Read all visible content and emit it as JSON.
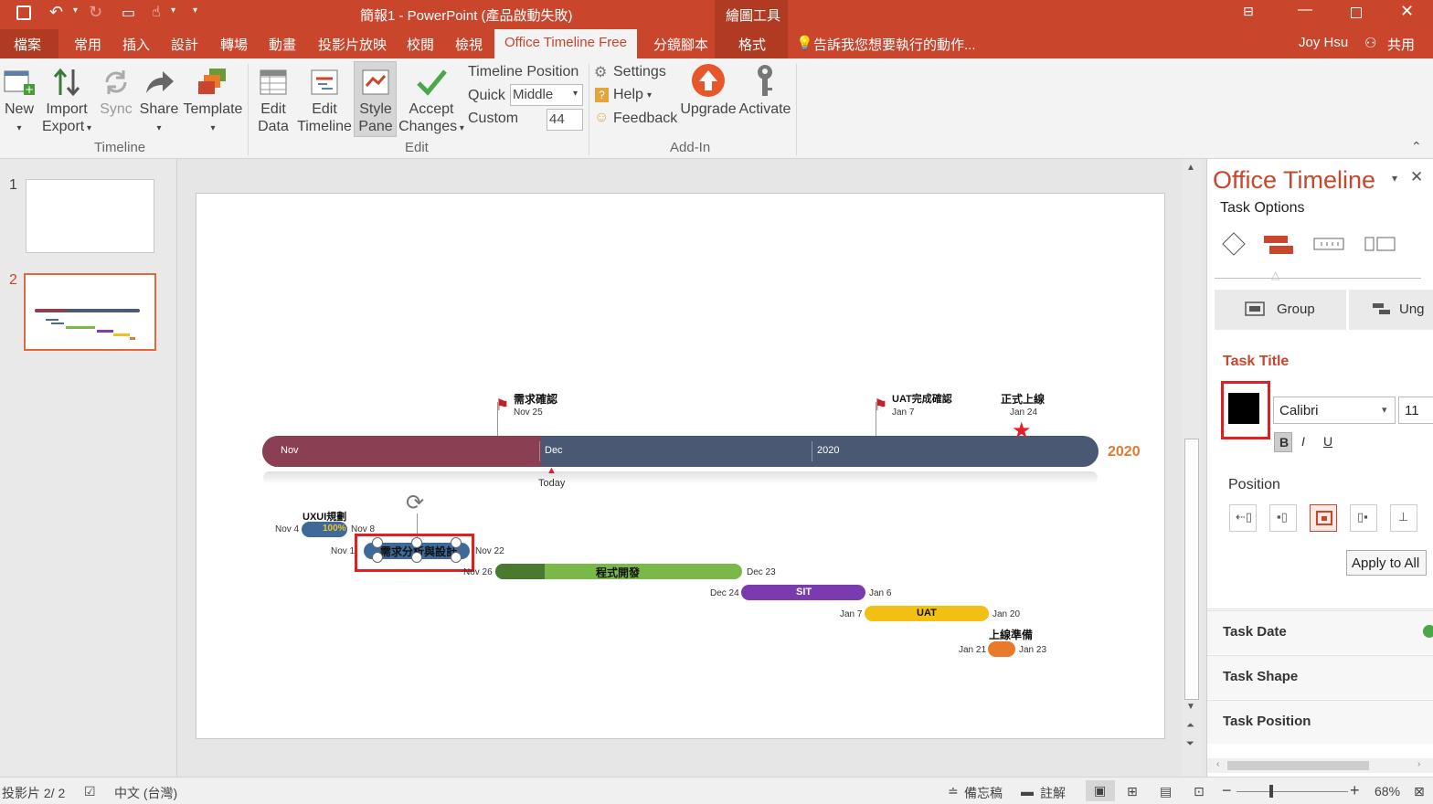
{
  "window": {
    "title": "簡報1 - PowerPoint (產品啟動失敗)",
    "contextual_tab_group": "繪圖工具"
  },
  "tabs": {
    "file": "檔案",
    "home": "常用",
    "insert": "插入",
    "design": "設計",
    "transitions": "轉場",
    "animations": "動畫",
    "slideshow": "投影片放映",
    "review": "校閱",
    "view": "檢視",
    "office_timeline": "Office Timeline Free",
    "storyboard": "分鏡腳本",
    "format": "格式",
    "tell_me": "告訴我您想要執行的動作...",
    "user": "Joy Hsu",
    "share": "共用"
  },
  "ribbon": {
    "new": "New",
    "import": "Import",
    "export": "Export",
    "sync": "Sync",
    "share": "Share",
    "template": "Template",
    "group_timeline": "Timeline",
    "edit_data_1": "Edit",
    "edit_data_2": "Data",
    "edit_timeline_1": "Edit",
    "edit_timeline_2": "Timeline",
    "style_pane_1": "Style",
    "style_pane_2": "Pane",
    "accept_1": "Accept",
    "accept_2": "Changes",
    "timeline_position": "Timeline Position",
    "quick": "Quick",
    "quick_value": "Middle",
    "custom": "Custom",
    "custom_value": "44",
    "group_edit": "Edit",
    "settings": "Settings",
    "help": "Help",
    "feedback": "Feedback",
    "upgrade": "Upgrade",
    "activate": "Activate",
    "group_addin": "Add-In"
  },
  "thumbnails": {
    "n1": "1",
    "n2": "2"
  },
  "timeline": {
    "milestones": [
      {
        "title": "需求確認",
        "date": "Nov 25"
      },
      {
        "title": "UAT完成確認",
        "date": "Jan 7"
      },
      {
        "title": "正式上線",
        "date": "Jan 24"
      }
    ],
    "band_nov": "Nov",
    "band_dec": "Dec",
    "band_2020": "2020",
    "year_label": "2020",
    "today": "Today",
    "tasks": [
      {
        "title": "UXUI規劃",
        "start": "Nov 4",
        "end": "Nov 8",
        "pct": "100%"
      },
      {
        "title": "需求分析與設計",
        "start": "Nov 1",
        "end": "Nov 22"
      },
      {
        "title": "程式開發",
        "start": "Nov 26",
        "end": "Dec 23"
      },
      {
        "title": "SIT",
        "start": "Dec 24",
        "end": "Jan 6"
      },
      {
        "title": "UAT",
        "start": "Jan 7",
        "end": "Jan 20"
      },
      {
        "title": "上線準備",
        "start": "Jan 21",
        "end": "Jan 23"
      }
    ]
  },
  "pane": {
    "title": "Office Timeline",
    "task_options": "Task Options",
    "group": "Group",
    "ungroup": "Ung",
    "task_title": "Task Title",
    "font": "Calibri",
    "size": "11",
    "bold": "B",
    "italic": "I",
    "underline": "U",
    "position": "Position",
    "apply_all": "Apply to All",
    "task_date": "Task Date",
    "task_shape": "Task Shape",
    "task_position": "Task Position",
    "accent": "#c9452c"
  },
  "status": {
    "slide": "投影片 2/ 2",
    "lang": "中文 (台灣)",
    "notes": "備忘稿",
    "comments": "註解",
    "zoom": "68%"
  }
}
